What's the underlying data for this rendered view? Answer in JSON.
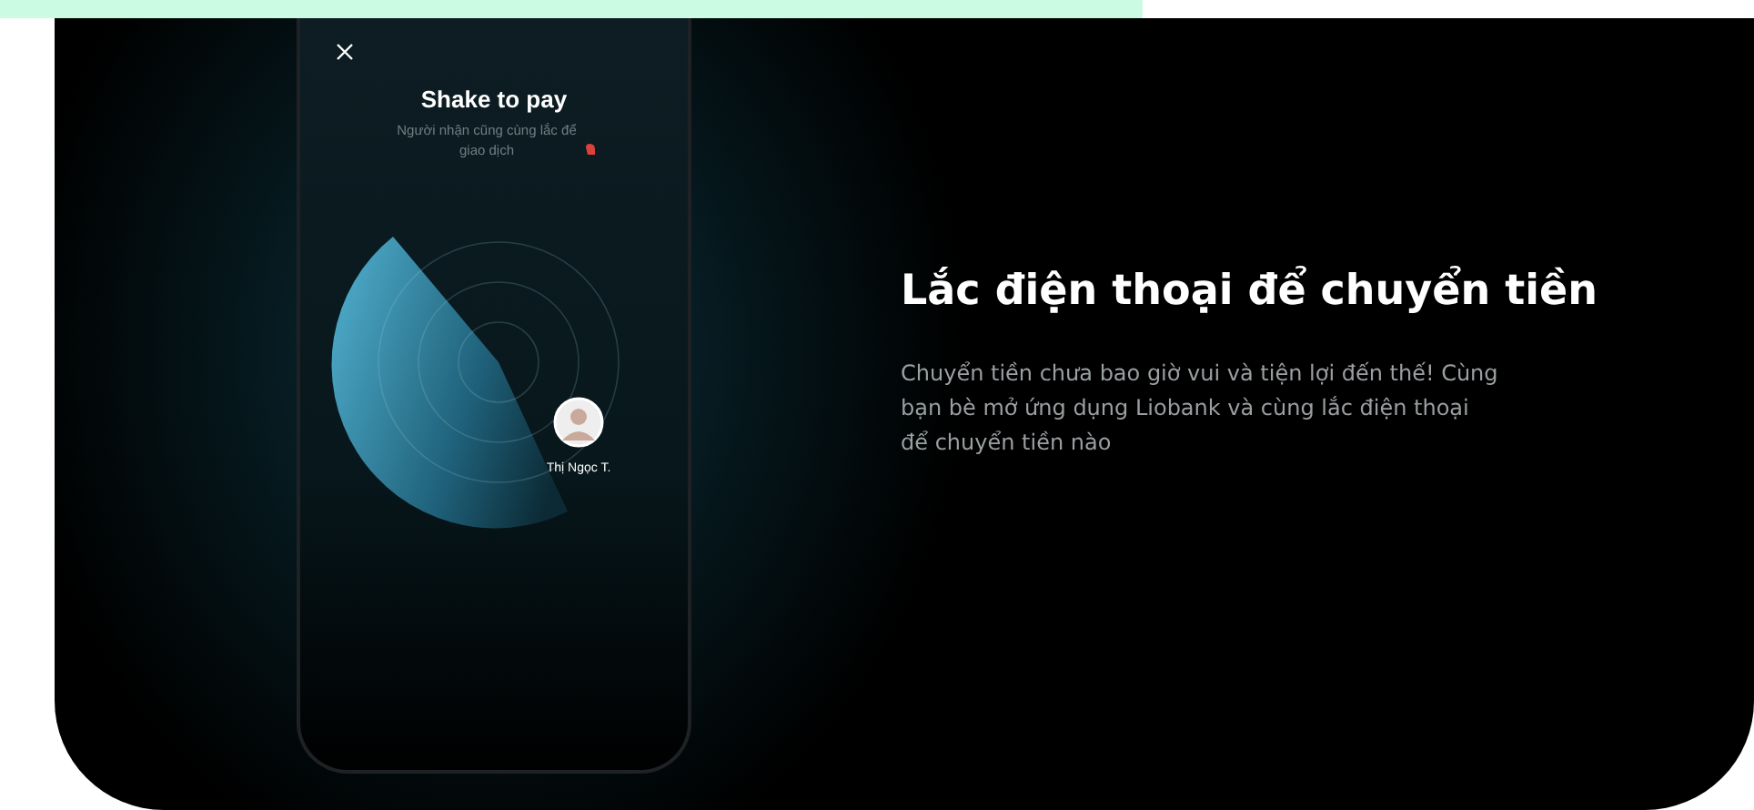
{
  "phone": {
    "title": "Shake to pay",
    "subtitle": "Người nhận cũng cùng lắc để giao dịch",
    "contact": {
      "name": "Thị Ngọc T."
    }
  },
  "feature": {
    "heading": "Lắc điện thoại để chuyển tiền",
    "description": "Chuyển tiền chưa bao giờ vui và tiện lợi đến thế! Cùng bạn bè mở ứng dụng Liobank và cùng lắc điện thoại để chuyển tiền nào"
  }
}
